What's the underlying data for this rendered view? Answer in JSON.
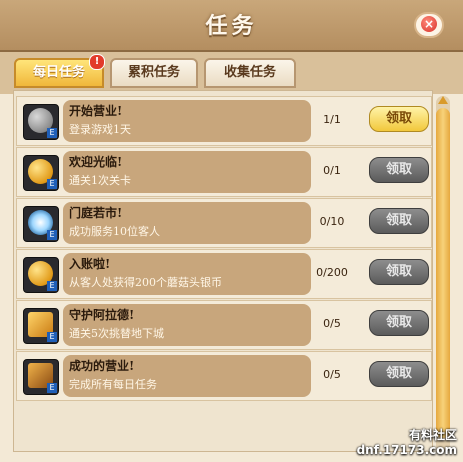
{
  "window": {
    "title": "任务",
    "close_label": "×"
  },
  "tabs": [
    {
      "label": "每日任务",
      "active": true,
      "badge": "!"
    },
    {
      "label": "累积任务",
      "active": false
    },
    {
      "label": "收集任务",
      "active": false
    }
  ],
  "tasks": [
    {
      "name": "开始营业!",
      "desc": "登录游戏1天",
      "progress": "1/1",
      "button": "领取",
      "claimable": true,
      "icon": "gear-coin-icon"
    },
    {
      "name": "欢迎光临!",
      "desc": "通关1次关卡",
      "progress": "0/1",
      "button": "领取",
      "claimable": false,
      "icon": "gold-coin-icon"
    },
    {
      "name": "门庭若市!",
      "desc": "成功服务10位客人",
      "progress": "0/10",
      "button": "领取",
      "claimable": false,
      "icon": "spark-icon"
    },
    {
      "name": "入账啦!",
      "desc": "从客人处获得200个蘑菇头银币",
      "progress": "0/200",
      "button": "领取",
      "claimable": false,
      "icon": "gold-coin-icon"
    },
    {
      "name": "守护阿拉德!",
      "desc": "通关5次挑替地下城",
      "progress": "0/5",
      "button": "领取",
      "claimable": false,
      "icon": "box-icon"
    },
    {
      "name": "成功的营业!",
      "desc": "完成所有每日任务",
      "progress": "0/5",
      "button": "领取",
      "claimable": false,
      "icon": "chest-icon"
    }
  ],
  "icon_tag": "E",
  "watermark": {
    "line1": "有料社区",
    "line2": "dnf.17173.com"
  },
  "colors": {
    "accent": "#f2c83c",
    "disabled": "#6b6b6b",
    "badge": "#e23b2b"
  }
}
